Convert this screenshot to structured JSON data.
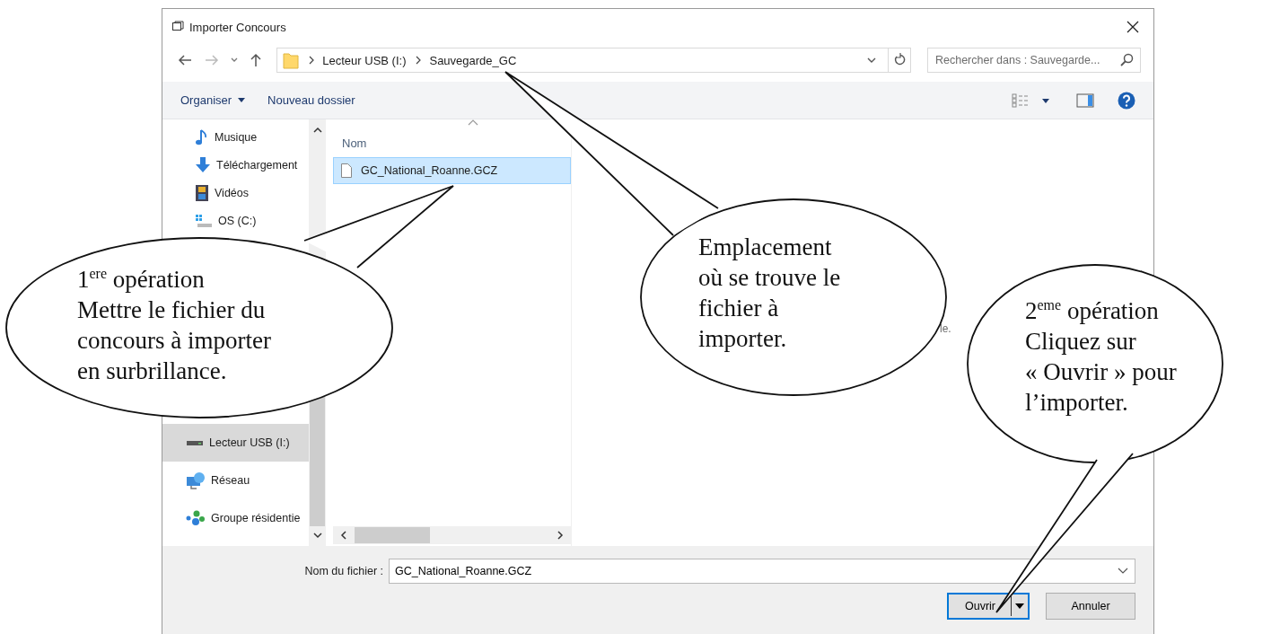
{
  "window": {
    "title": "Importer Concours"
  },
  "address_bar": {
    "path": [
      "Lecteur USB (I:)",
      "Sauvegarde_GC"
    ]
  },
  "search": {
    "placeholder": "Rechercher dans : Sauvegarde..."
  },
  "toolbar": {
    "organize": "Organiser",
    "new_folder": "Nouveau dossier"
  },
  "sidebar": {
    "quick_access": [
      {
        "label": "Musique",
        "kind": "music",
        "selected": false
      },
      {
        "label": "Téléchargement",
        "kind": "download",
        "selected": false
      },
      {
        "label": "Vidéos",
        "kind": "video",
        "selected": false
      },
      {
        "label": "OS (C:)",
        "kind": "system",
        "selected": false
      }
    ],
    "devices": [
      {
        "label": "Lecteur USB (I:)",
        "kind": "usb",
        "selected": true
      },
      {
        "label": "Réseau",
        "kind": "network",
        "selected": false
      },
      {
        "label": "Groupe résidentie",
        "kind": "homegroup",
        "selected": false
      }
    ]
  },
  "file_list": {
    "column": "Nom",
    "files": [
      {
        "name": "GC_National_Roanne.GCZ",
        "selected": true
      }
    ]
  },
  "preview_text": "le.",
  "file_name": {
    "label": "Nom du fichier :",
    "value": "GC_National_Roanne.GCZ"
  },
  "buttons": {
    "open": "Ouvrir",
    "cancel": "Annuler"
  },
  "callouts": [
    {
      "lines": [
        "1$^{ere}$ opération",
        "Mettre le fichier du",
        "concours à importer",
        "en surbrillance."
      ]
    },
    {
      "lines": [
        "Emplacement",
        "où se trouve le",
        "fichier à",
        "importer."
      ]
    },
    {
      "lines": [
        "2$^{eme}$ opération",
        "Cliquez sur",
        "« Ouvrir » pour",
        "l’importer."
      ]
    }
  ]
}
